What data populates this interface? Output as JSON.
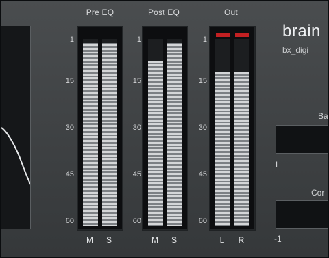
{
  "groups": {
    "pre": {
      "label": "Pre EQ",
      "channels": [
        "M",
        "S"
      ],
      "levels": [
        0.981,
        0.981
      ]
    },
    "post": {
      "label": "Post EQ",
      "channels": [
        "M",
        "S"
      ],
      "levels": [
        0.882,
        0.981
      ]
    },
    "out": {
      "label": "Out",
      "channels": [
        "L",
        "R"
      ],
      "levels": [
        0.823,
        0.823
      ],
      "clip": [
        true,
        true
      ]
    }
  },
  "scale_ticks": [
    "1",
    "15",
    "30",
    "45",
    "60"
  ],
  "brand": {
    "title": "brain",
    "subtitle": "bx_digi"
  },
  "right_panel": {
    "balance_label": "Ba",
    "balance_left": "L",
    "correlation_label": "Cor",
    "correlation_min": "-1"
  },
  "colors": {
    "accent_border": "#2aa6d6",
    "clip_red": "#c22022"
  }
}
